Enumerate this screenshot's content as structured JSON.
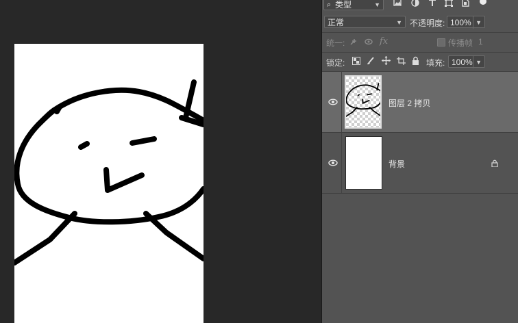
{
  "filter": {
    "kind_label": "类型"
  },
  "blend": {
    "mode": "正常",
    "opacity_label": "不透明度:",
    "opacity_value": "100%"
  },
  "unify": {
    "label": "统一:",
    "propagate_label": "传播帧",
    "frame_number": "1"
  },
  "lock": {
    "label": "锁定:",
    "fill_label": "填充:",
    "fill_value": "100%"
  },
  "layers": [
    {
      "name": "图层 2 拷贝",
      "selected": true
    },
    {
      "name": "背景",
      "locked": true
    }
  ]
}
